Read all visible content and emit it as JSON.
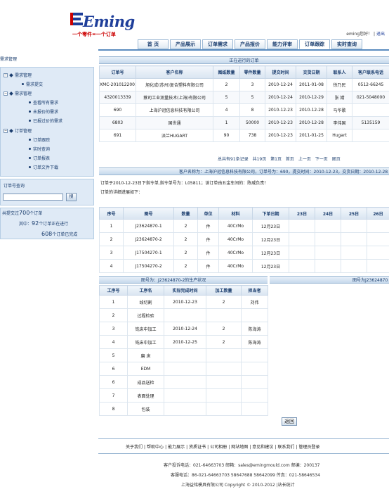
{
  "brand": {
    "name": "Eming",
    "slogan": "一个零件=一个订单"
  },
  "user_bar": {
    "greeting": "eming您好！",
    "logout": "退出",
    "sep": "|"
  },
  "nav": [
    "首 页",
    "产品展示",
    "订单需求",
    "产品报价",
    "能力评审",
    "订单跟踪",
    "实时查询"
  ],
  "sidebar": {
    "title": "需求管理",
    "tree": [
      {
        "label": "需求管理",
        "level": 0
      },
      {
        "label": "需求提交",
        "level": 1
      },
      {
        "label": "需求管理",
        "level": 0
      },
      {
        "label": "查看所有需求",
        "level": 2
      },
      {
        "label": "未报价的需求",
        "level": 2
      },
      {
        "label": "已报过价的需求",
        "level": 2
      },
      {
        "label": "订单管理",
        "level": 0
      },
      {
        "label": "订单跟踪",
        "level": 2
      },
      {
        "label": "实时查询",
        "level": 2
      },
      {
        "label": "订单报表",
        "level": 2
      },
      {
        "label": "订单文件下载",
        "level": 2
      }
    ],
    "order_search_title": "订单号查询",
    "search_button": "搜",
    "stats": {
      "total_prefix": "共提交过",
      "total_count": "700",
      "total_suffix": "个订单",
      "active_prefix": "其中：",
      "active_count": "92",
      "active_suffix": "个订单正在进行",
      "done_count": "608",
      "done_suffix": "个订单已完成"
    }
  },
  "orders": {
    "title": "正在进行的订单",
    "columns": [
      "订单号",
      "客户名称",
      "图纸数量",
      "零件数量",
      "提交时间",
      "交货日期",
      "联系人",
      "客户联系电话"
    ],
    "rows": [
      [
        "XMC-2010122001",
        "旭化成(苏州)复合塑料有限公司",
        "2",
        "3",
        "2010-12-24",
        "2011-01-08",
        "徐乃民",
        "0512-66245"
      ],
      [
        "4320013339",
        "蔡司工业测量技术(上海)有限公司",
        "5",
        "5",
        "2010-12-24",
        "2010-12-29",
        "张 婧",
        "021-5048000"
      ],
      [
        "690",
        "上海沪冠信息科技有限公司",
        "4",
        "8",
        "2010-12-23",
        "2010-12-28",
        "马华歌",
        ""
      ],
      [
        "6803",
        "国世通",
        "1",
        "50000",
        "2010-12-23",
        "2010-12-28",
        "李伟国",
        "5135159"
      ],
      [
        "691",
        "派兰HUGART",
        "90",
        "738",
        "2010-12-23",
        "2011-01-25",
        "Hugart",
        ""
      ]
    ],
    "pager": [
      "总共有91条记录",
      "共19页",
      "第1页",
      "首页",
      "上一页",
      "下一页",
      "尾页"
    ]
  },
  "detail": {
    "header": "客户名称为：上海沪冠信息科技有限公司，订单号为：690，提交时间：2010-12-23，交货日期：2010-12-28",
    "line1": "订单于2010-12-23日下指令单,指令单号为：L05811；该订单由五金车间的：陈威负责！",
    "line2": "订单的详细进展如下："
  },
  "parts": {
    "columns": [
      "序号",
      "图号",
      "数量",
      "单位",
      "材料",
      "下单日期",
      "23日",
      "24日",
      "25日",
      "26日"
    ],
    "rows": [
      [
        "1",
        "J23624870-1",
        "2",
        "件",
        "40CrMo",
        "12月23日"
      ],
      [
        "2",
        "J23624870-2",
        "2",
        "件",
        "40CrMo",
        "12月23日"
      ],
      [
        "3",
        "J17504270-1",
        "2",
        "件",
        "40CrMo",
        "12月23日"
      ],
      [
        "4",
        "J17504270-2",
        "2",
        "件",
        "40CrMo",
        "12月23日"
      ]
    ]
  },
  "process": {
    "title_left": "图号为：J23624870-2的生产状况",
    "title_right": "图号为J23624870",
    "columns": [
      "工序号",
      "工序名",
      "实际完成时间",
      "加工数量",
      "担当者"
    ],
    "rows": [
      [
        "1",
        "线切割",
        "2010-12-23",
        "2",
        "刘伟"
      ],
      [
        "2",
        "过程检验",
        "",
        "",
        ""
      ],
      [
        "3",
        "铣床中加工",
        "2010-12-24",
        "2",
        "陈海涛"
      ],
      [
        "4",
        "铣床中加工",
        "2010-12-25",
        "2",
        "陈海涛"
      ],
      [
        "5",
        "磨 床",
        "",
        "",
        ""
      ],
      [
        "6",
        "EDM",
        "",
        "",
        ""
      ],
      [
        "6",
        "成品送检",
        "",
        "",
        ""
      ],
      [
        "7",
        "表面处理",
        "",
        "",
        ""
      ],
      [
        "8",
        "包装",
        "",
        "",
        ""
      ]
    ]
  },
  "back_button": "返回",
  "footer": {
    "links": [
      "关于我们",
      "帮助中心",
      "能力展示",
      "资质证书",
      "公司相册",
      "网站地图",
      "意见和建议",
      "联系我们",
      "管理员登录"
    ],
    "sep": "|",
    "line1": "客户投诉电话：021-64663703 邮箱：sales@emingmould.com 邮编：200137",
    "line2": "客服电话：86-021-64663703 58647688 58642099 传真：021-58646534",
    "line3": "上海益铭模具有限公司 Copyright © 2010-2012 |站长统计"
  }
}
